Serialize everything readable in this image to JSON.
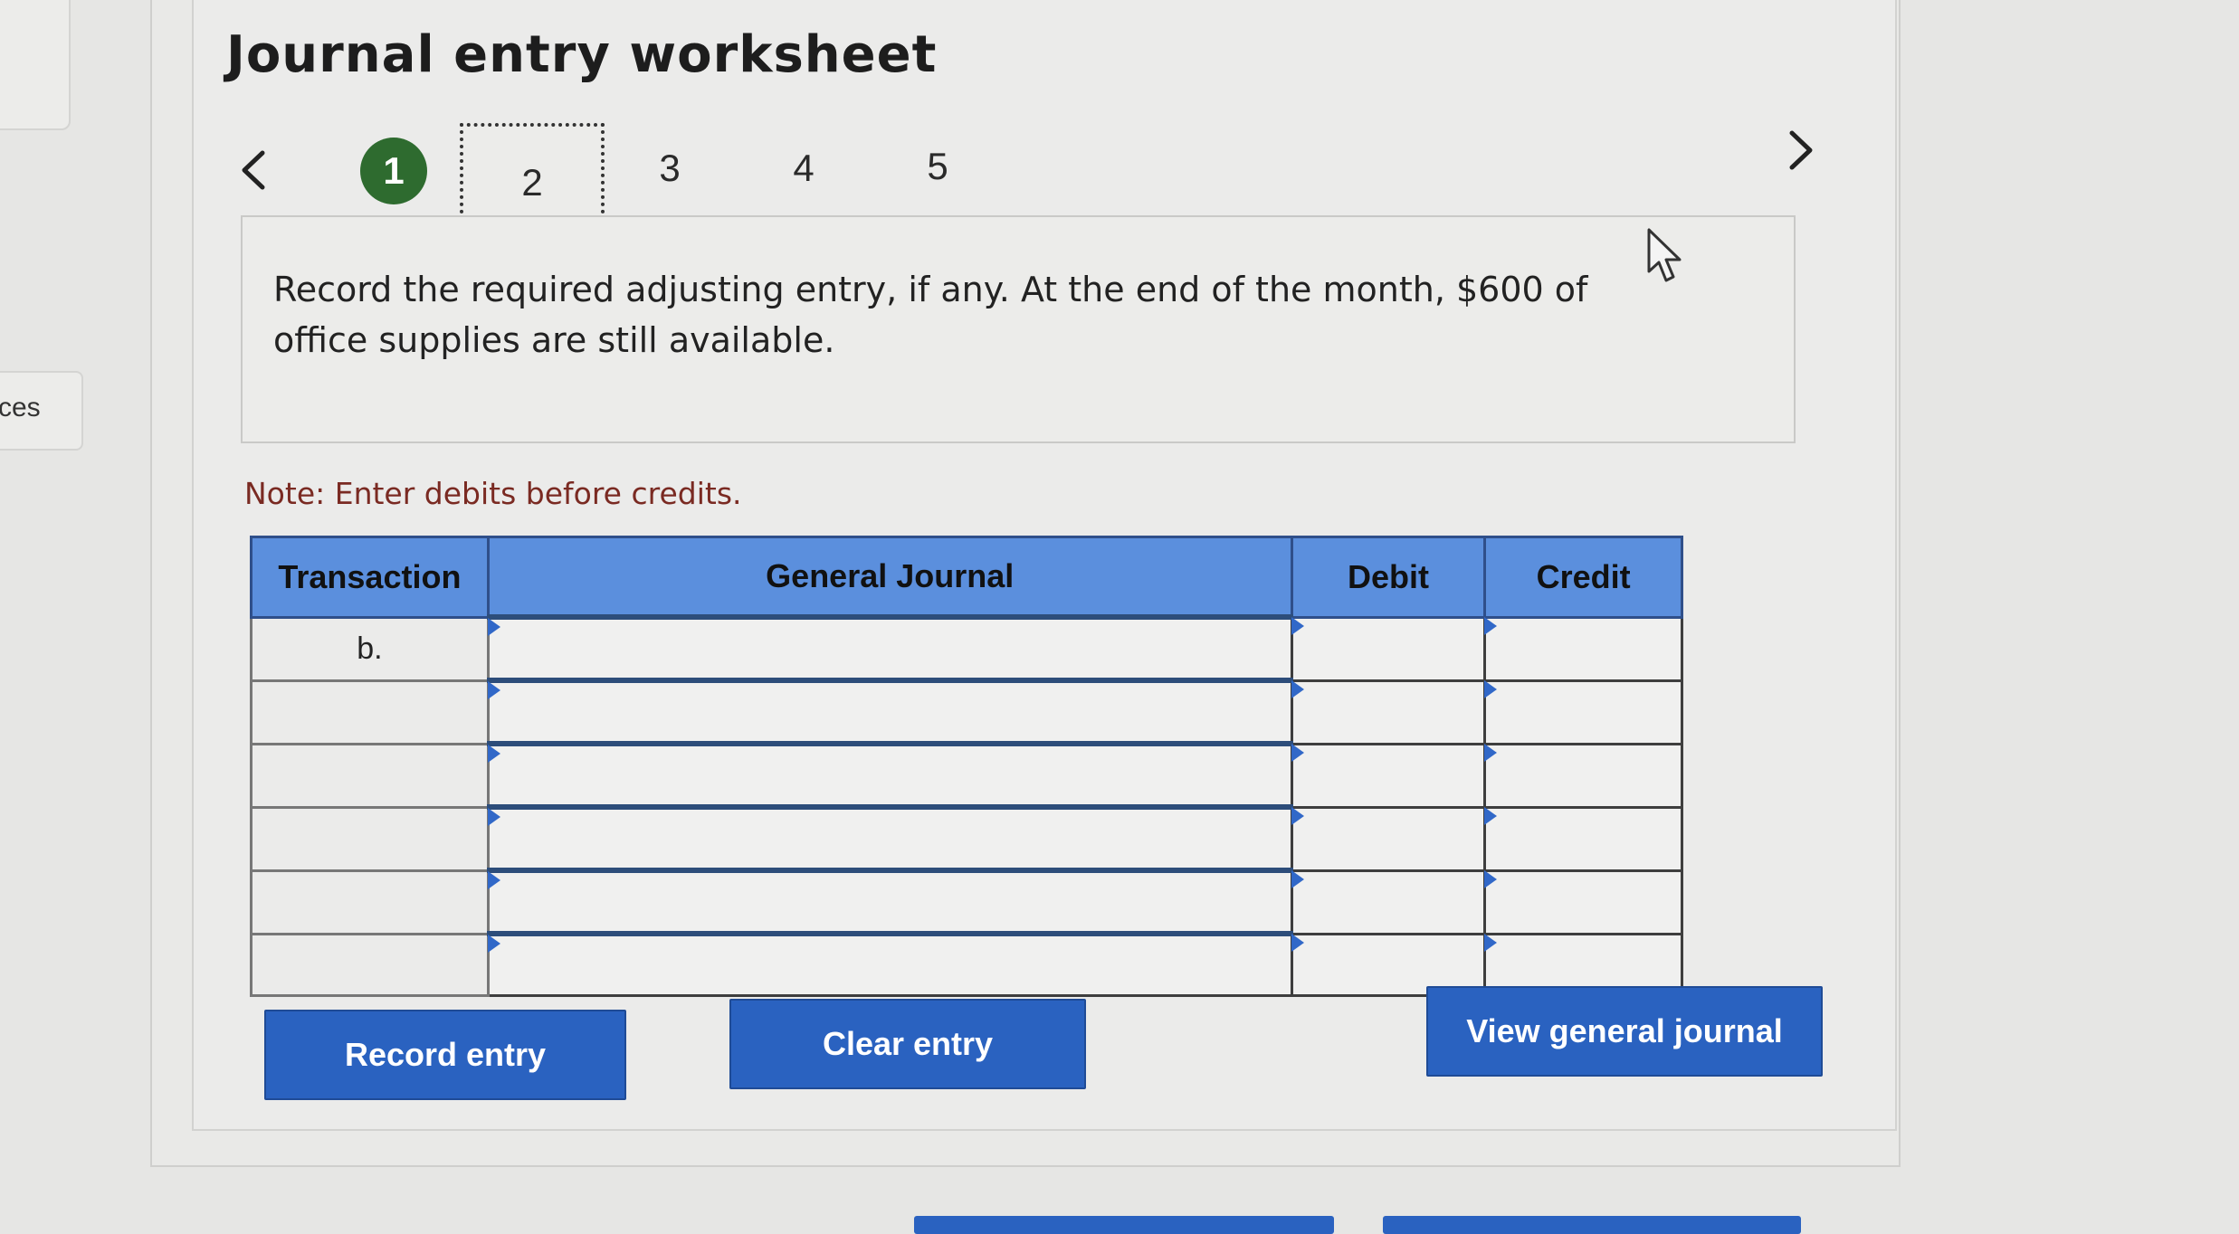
{
  "sidebar": {
    "tab_label": "ces"
  },
  "header": {
    "title": "Journal entry worksheet"
  },
  "steps": {
    "items": [
      "1",
      "2",
      "3",
      "4",
      "5"
    ],
    "active_index": 0,
    "focused_index": 1
  },
  "question": {
    "text": "Record the required adjusting entry, if any. At the end of the month, $600 of office supplies are still available."
  },
  "note": "Note: Enter debits before credits.",
  "table": {
    "columns": [
      "Transaction",
      "General Journal",
      "Debit",
      "Credit"
    ],
    "rows": [
      {
        "transaction": "b.",
        "general_journal": "",
        "debit": "",
        "credit": ""
      },
      {
        "transaction": "",
        "general_journal": "",
        "debit": "",
        "credit": ""
      },
      {
        "transaction": "",
        "general_journal": "",
        "debit": "",
        "credit": ""
      },
      {
        "transaction": "",
        "general_journal": "",
        "debit": "",
        "credit": ""
      },
      {
        "transaction": "",
        "general_journal": "",
        "debit": "",
        "credit": ""
      },
      {
        "transaction": "",
        "general_journal": "",
        "debit": "",
        "credit": ""
      }
    ]
  },
  "buttons": {
    "record_entry": "Record entry",
    "clear_entry": "Clear entry",
    "view_general_journal": "View general journal"
  },
  "colors": {
    "accent": "#2a62c0",
    "table_header": "#5b8fdd",
    "active_step": "#2e6b2f",
    "note_text": "#7a2a22"
  },
  "icons": {
    "prev": "chevron-left-icon",
    "next": "chevron-right-icon",
    "cursor": "mouse-pointer-icon"
  }
}
